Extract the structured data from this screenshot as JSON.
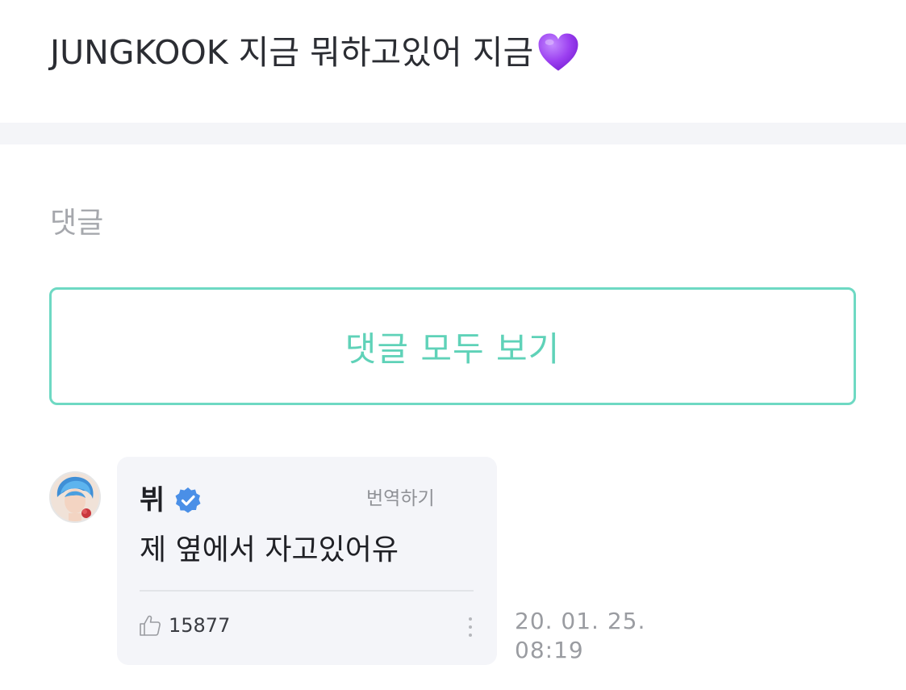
{
  "post": {
    "text": "JUNGKOOK 지금 뭐하고있어 지금",
    "emoji_icon": "purple-heart-icon",
    "emoji_color": "#9b3ff0"
  },
  "comments_section": {
    "heading": "댓글",
    "view_all_label": "댓글 모두 보기",
    "accent_color": "#6ed9c3"
  },
  "comment": {
    "author": "뷔",
    "verified_icon": "verified-badge-icon",
    "verified_color": "#4a8fe7",
    "translate_label": "번역하기",
    "body": "제 옆에서 자고있어유",
    "like_icon": "thumbs-up-icon",
    "like_count": "15877",
    "more_icon": "more-vertical-icon",
    "date": "20. 01. 25.",
    "time": "08:19"
  }
}
